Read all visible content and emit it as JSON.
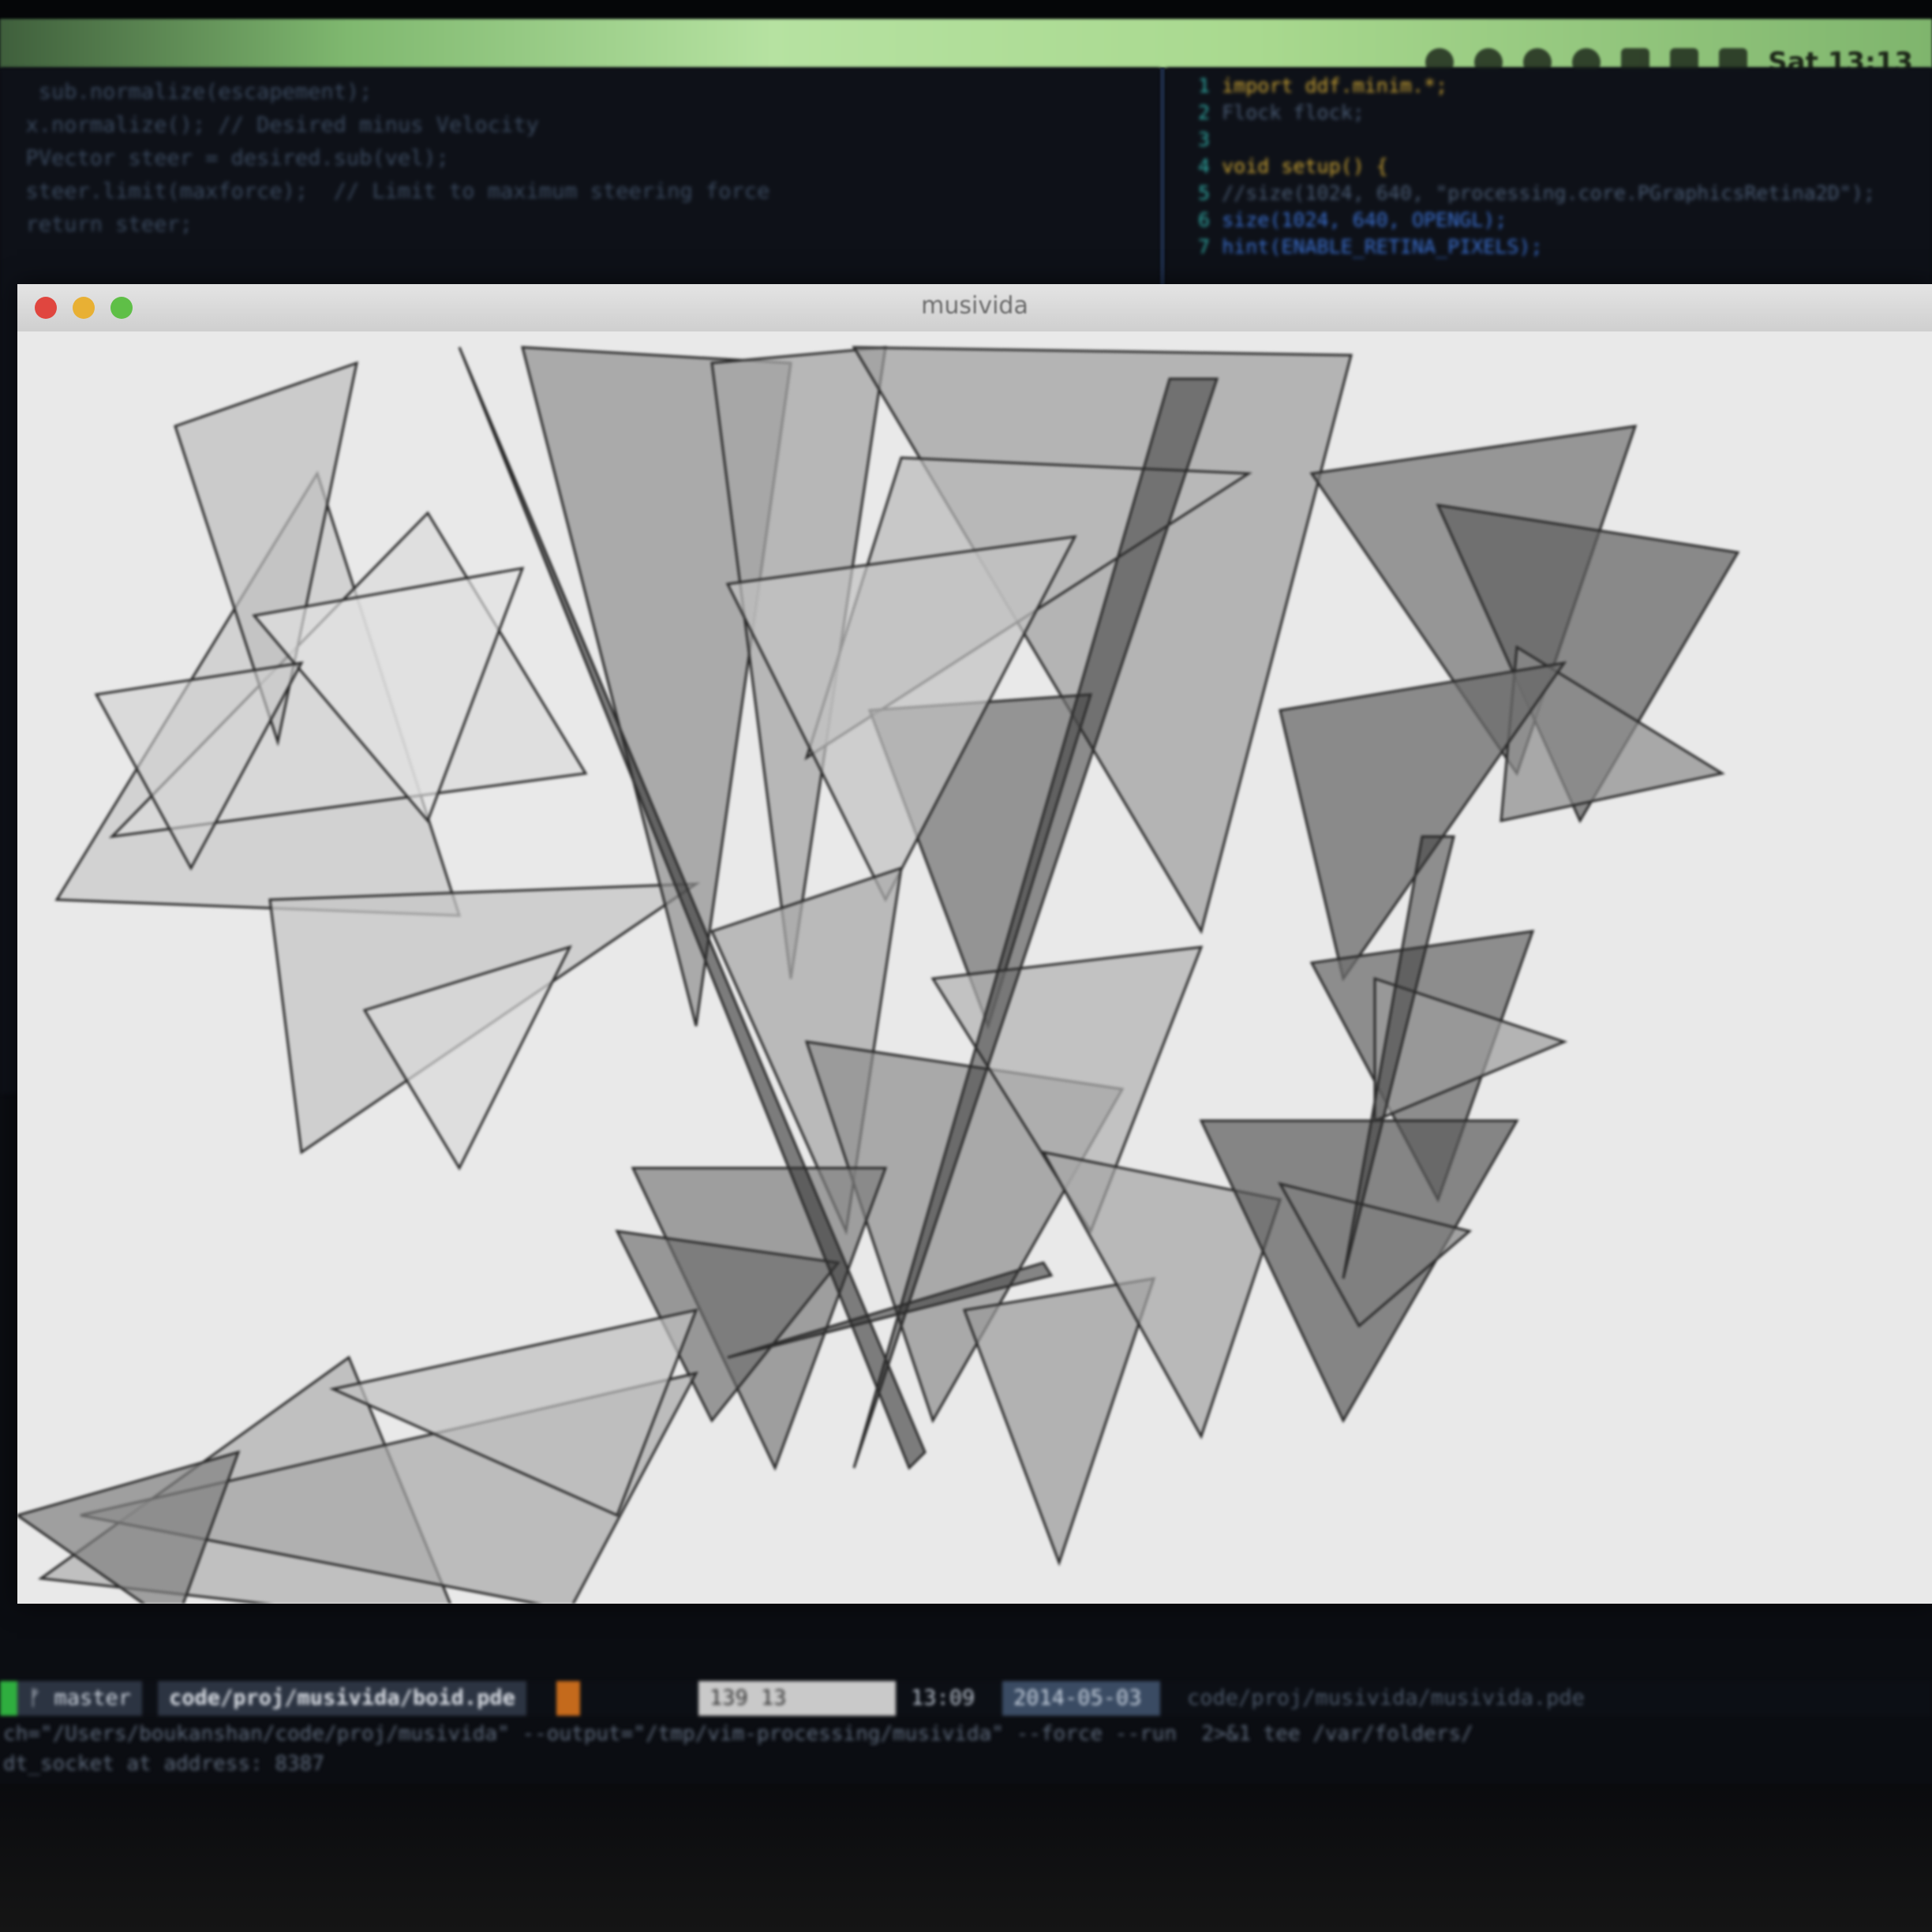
{
  "menubar": {
    "icons": [
      "status-icon",
      "wifi-icon",
      "person-icon",
      "clock-icon",
      "clipboard-icon",
      "menu-icon",
      "keyboard-icon"
    ],
    "clock": "Sat 13:13"
  },
  "editor_left": {
    "lines": [
      "   sub.normalize(escapement);",
      "  x.normalize(); // Desired minus Velocity",
      "  PVector steer = desired.sub(vel);",
      "  steer.limit(maxforce);  // Limit to maximum steering force",
      "",
      "  return steer;"
    ]
  },
  "editor_right": {
    "line_numbers": [
      "1",
      "2",
      "3",
      "4",
      "5",
      "6",
      "7"
    ],
    "lines": [
      "import ddf.minim.*;",
      "Flock flock;",
      "",
      "void setup() {",
      "  //size(1024, 640, \"processing.core.PGraphicsRetina2D\");",
      "  size(1024, 640, OPENGL);",
      "  hint(ENABLE_RETINA_PIXELS);"
    ]
  },
  "app_window": {
    "title": "musivida"
  },
  "statusline": {
    "branch": "ᚠ master",
    "path": "code/proj/musivida/boid.pde",
    "position": "139  13",
    "time": "13:09",
    "date": "2014-05-03",
    "right": "code/proj/musivida/musivida.pde"
  },
  "cmdline": {
    "line1": "ch=\"/Users/boukanshan/code/proj/musivida\" --output=\"/tmp/vim-processing/musivida\" --force --run  2>&1 tee /var/folders/",
    "line2": "dt_socket at address: 8387"
  }
}
